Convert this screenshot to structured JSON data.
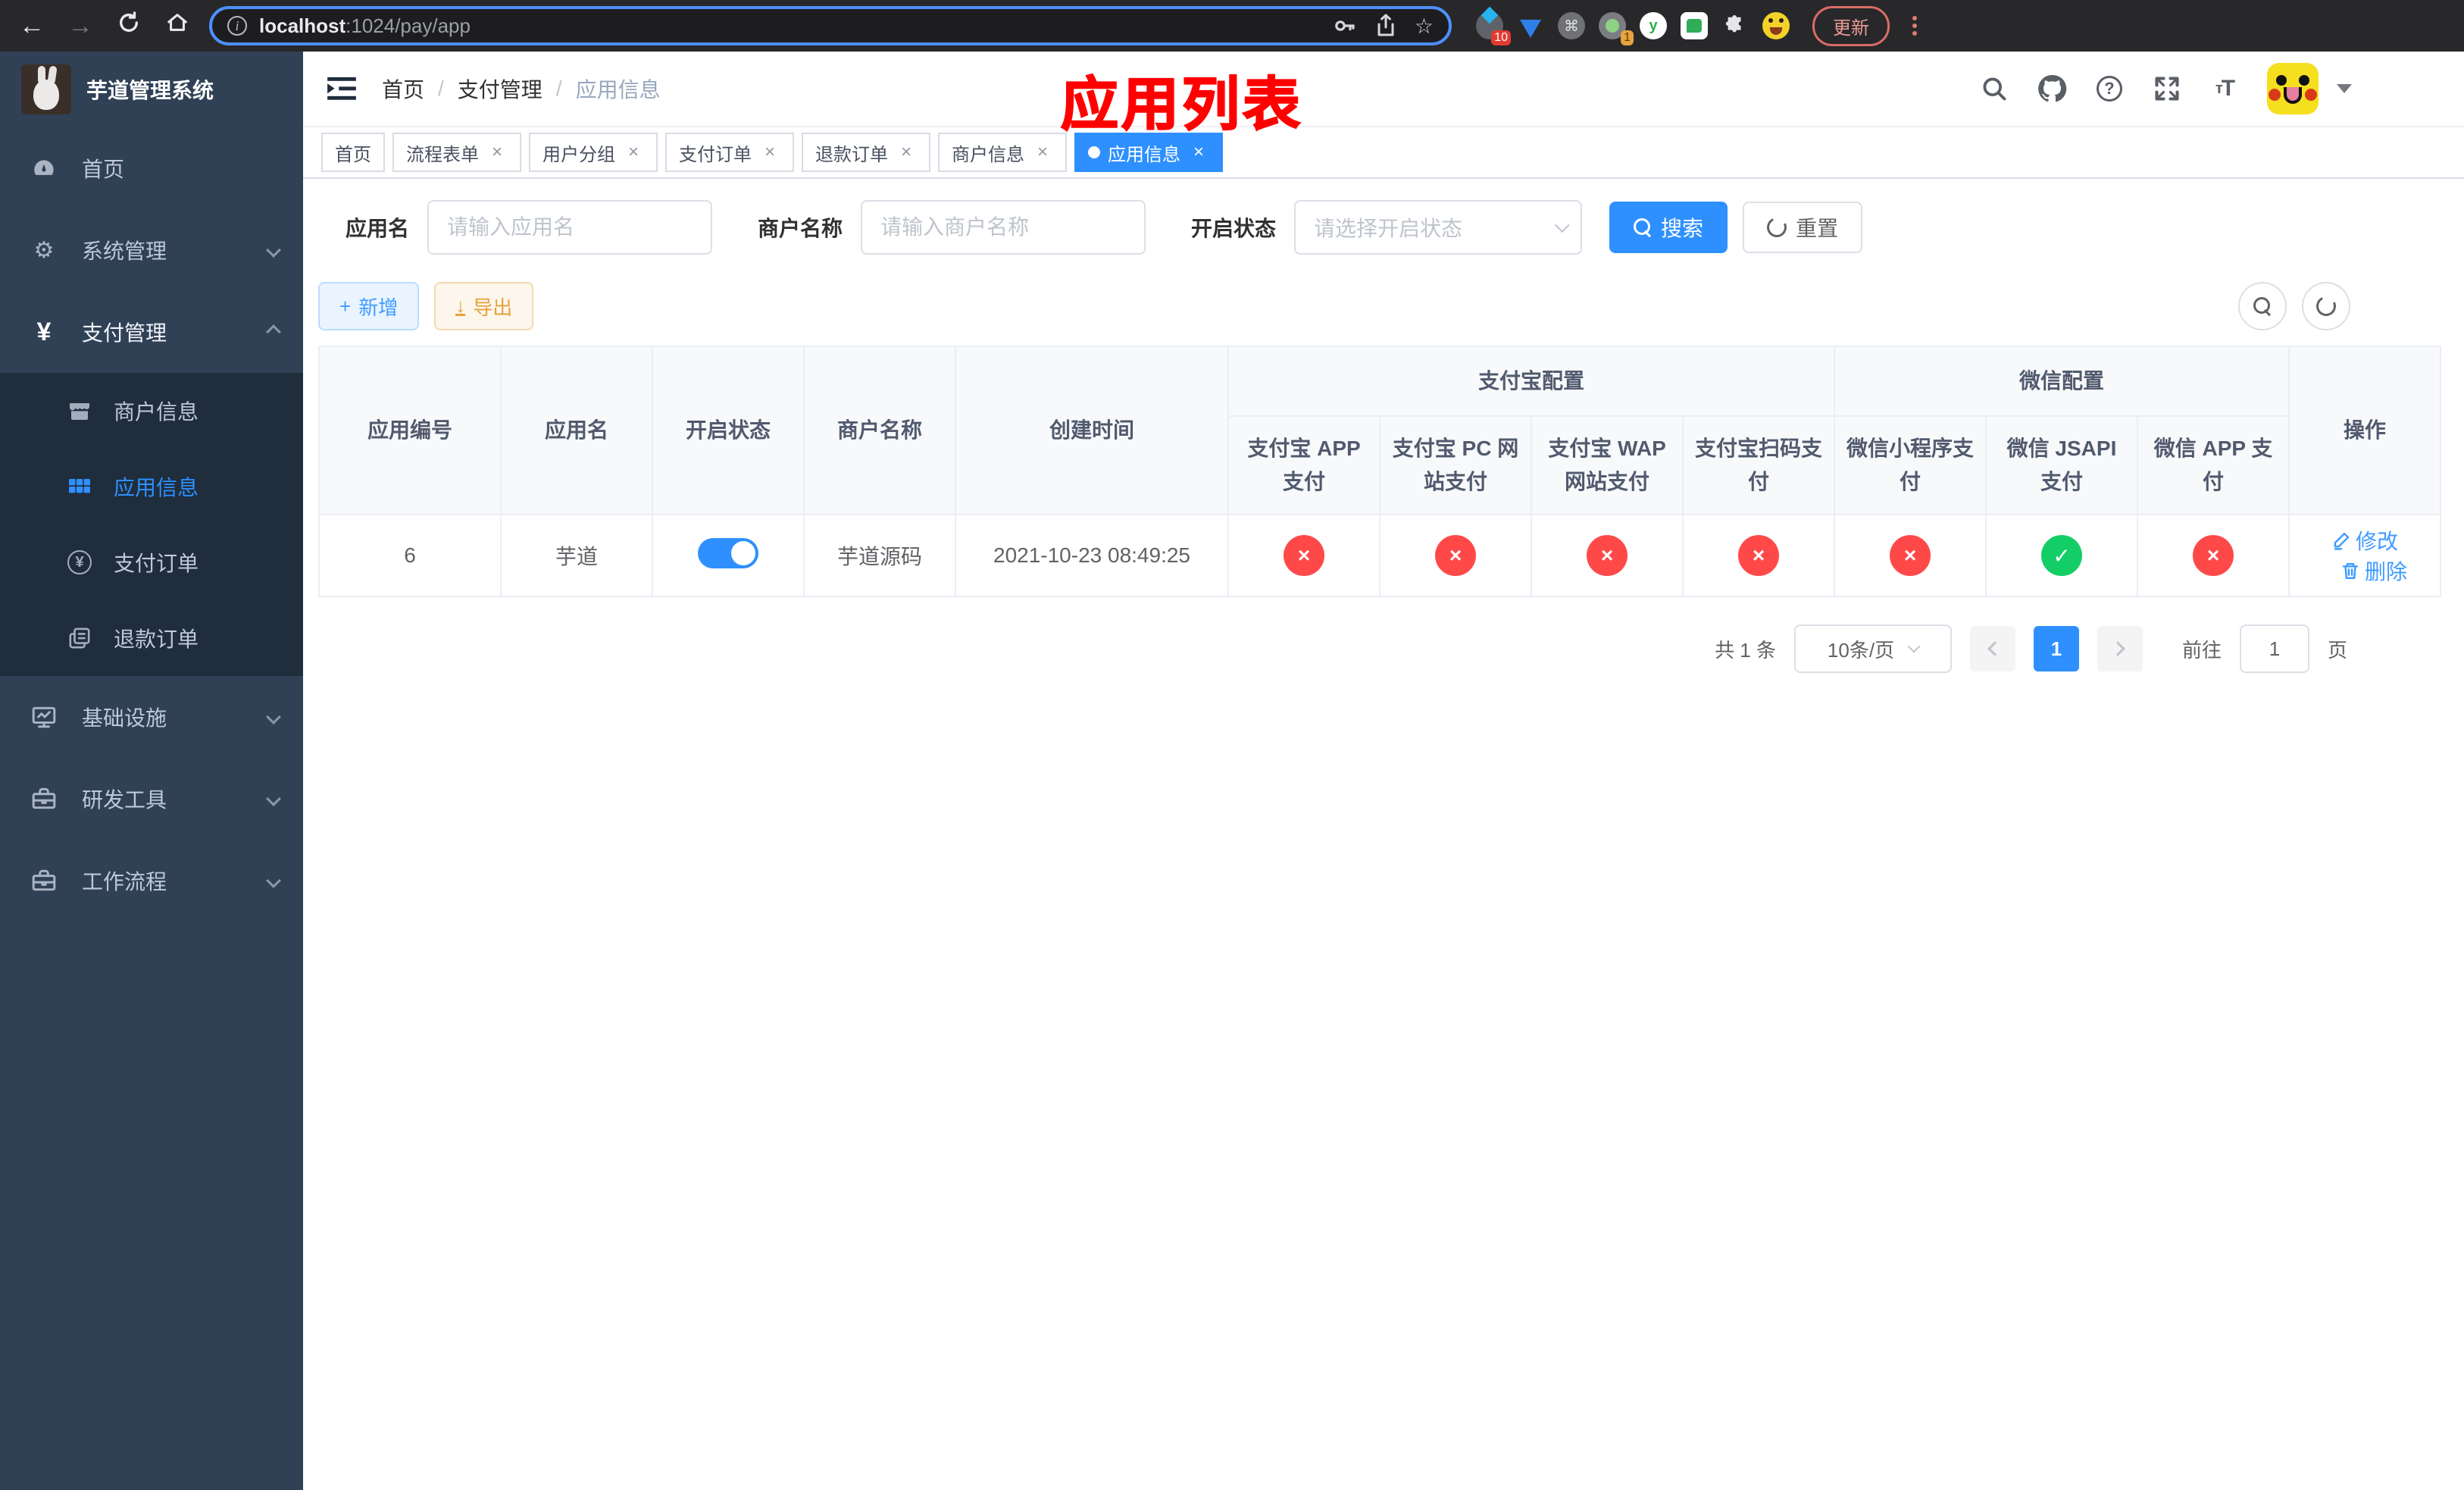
{
  "browser": {
    "url_host": "localhost",
    "url_rest": ":1024/pay/app",
    "update_label": "更新",
    "ext_badge_10": "10",
    "ext_badge_1": "1",
    "ext_y": "y",
    "command_glyph": "⌘",
    "star_glyph": "☆",
    "info_glyph": "i"
  },
  "sidebar": {
    "app_title": "芋道管理系统",
    "menu": [
      {
        "label": "首页"
      },
      {
        "label": "系统管理"
      },
      {
        "label": "支付管理",
        "children": [
          {
            "label": "商户信息"
          },
          {
            "label": "应用信息"
          },
          {
            "label": "支付订单"
          },
          {
            "label": "退款订单"
          }
        ]
      },
      {
        "label": "基础设施"
      },
      {
        "label": "研发工具"
      },
      {
        "label": "工作流程"
      }
    ],
    "yen_glyph": "¥",
    "gear_glyph": "⚙"
  },
  "navbar": {
    "breadcrumb": [
      "首页",
      "支付管理",
      "应用信息"
    ],
    "separator": "/"
  },
  "annotation": {
    "title": "应用列表",
    "color": "#FE0000"
  },
  "tabs": [
    {
      "label": "首页",
      "closable": false,
      "active": false
    },
    {
      "label": "流程表单",
      "closable": true,
      "active": false
    },
    {
      "label": "用户分组",
      "closable": true,
      "active": false
    },
    {
      "label": "支付订单",
      "closable": true,
      "active": false
    },
    {
      "label": "退款订单",
      "closable": true,
      "active": false
    },
    {
      "label": "商户信息",
      "closable": true,
      "active": false
    },
    {
      "label": "应用信息",
      "closable": true,
      "active": true
    }
  ],
  "filter": {
    "app_name_label": "应用名",
    "app_name_placeholder": "请输入应用名",
    "merchant_label": "商户名称",
    "merchant_placeholder": "请输入商户名称",
    "status_label": "开启状态",
    "status_placeholder": "请选择开启状态",
    "search_label": "搜索",
    "reset_label": "重置"
  },
  "toolbar": {
    "add_label": "新增",
    "export_label": "导出"
  },
  "table": {
    "group_headers": {
      "alipay": "支付宝配置",
      "wechat": "微信配置"
    },
    "headers": [
      "应用编号",
      "应用名",
      "开启状态",
      "商户名称",
      "创建时间",
      "支付宝 APP 支付",
      "支付宝 PC 网站支付",
      "支付宝 WAP 网站支付",
      "支付宝扫码支付",
      "微信小程序支付",
      "微信 JSAPI 支付",
      "微信 APP 支付",
      "操作"
    ],
    "rows": [
      {
        "id": "6",
        "name": "芋道",
        "enabled": true,
        "merchant": "芋道源码",
        "created": "2021-10-23 08:49:25",
        "configs": {
          "alipay_app": false,
          "alipay_pc": false,
          "alipay_wap": false,
          "alipay_qr": false,
          "wx_mini": false,
          "wx_jsapi": true,
          "wx_app": false
        },
        "actions": {
          "edit": "修改",
          "delete": "删除"
        }
      }
    ]
  },
  "pagination": {
    "total_text": "共 1 条",
    "page_size_text": "10条/页",
    "current_page": "1",
    "goto_label": "前往",
    "goto_value": "1",
    "page_unit": "页"
  },
  "glyphs": {
    "check": "✓",
    "cross": "×",
    "close": "×",
    "plus": "+",
    "download": "↓",
    "question": "?",
    "font_size_big": "T",
    "font_size_small": "т"
  },
  "colors": {
    "primary": "#2E90FF",
    "success": "#13CE66",
    "danger": "#FF4949",
    "sidebar_bg": "#304156",
    "submenu_bg": "#1F2D3D",
    "annotation": "#FE0000",
    "export_accent": "#E6A23C",
    "tab_border": "#D8DCE5"
  }
}
